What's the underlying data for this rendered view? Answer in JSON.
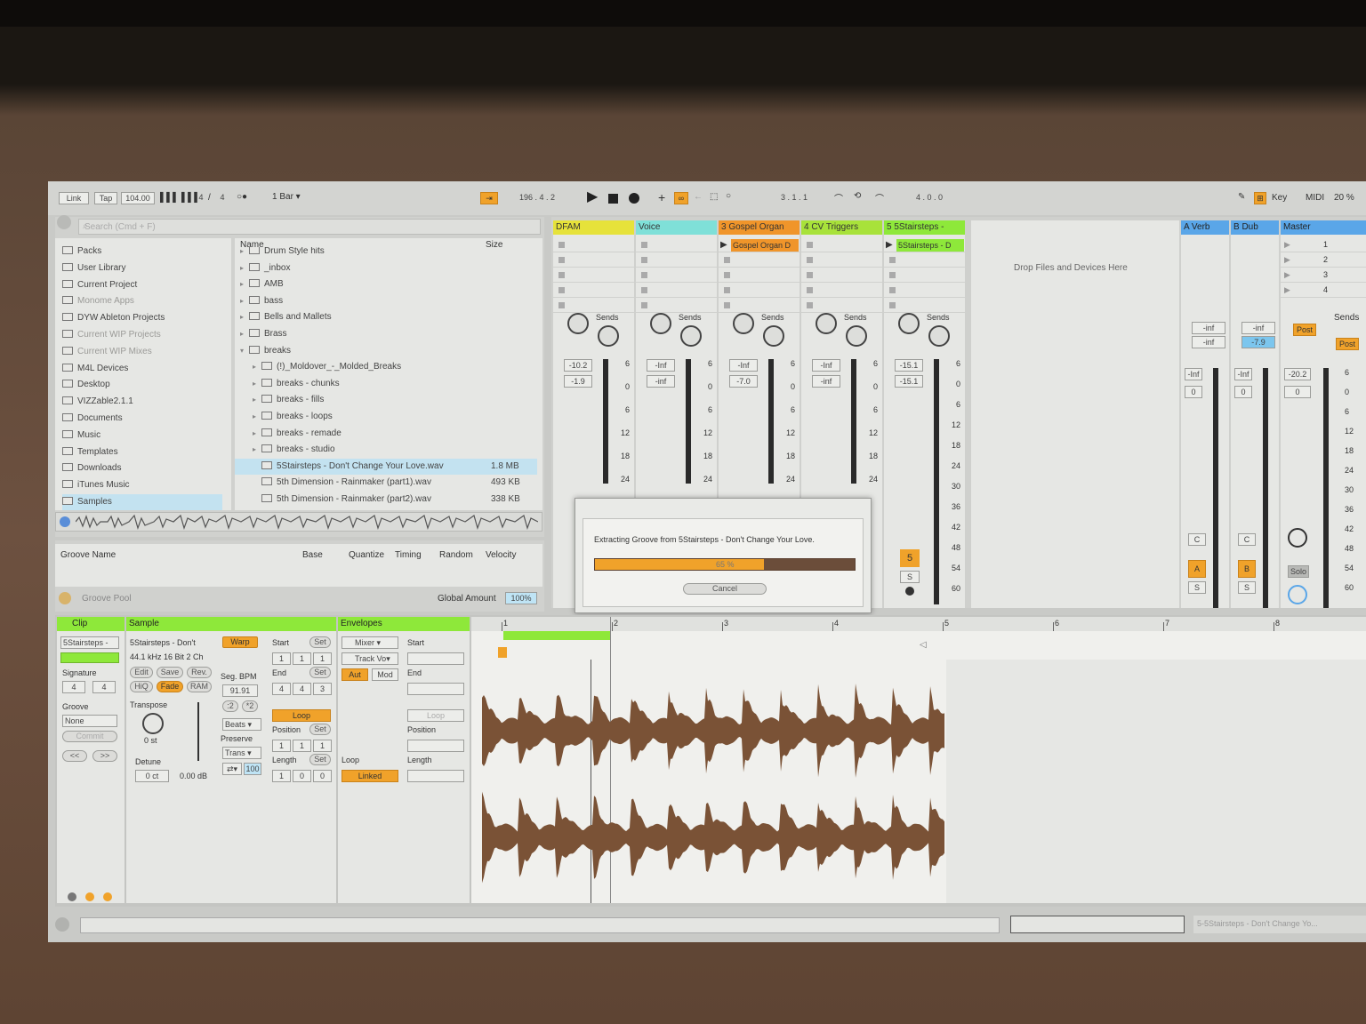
{
  "transport": {
    "link": "Link",
    "tap": "Tap",
    "tempo": "104.00",
    "signature_num": "4",
    "signature_sep": "/",
    "signature_den": "4",
    "quantize": "1 Bar",
    "position": "196 .   4 .   2",
    "loop_start": "3 .   1 .   1",
    "loop_length": "4 .   0 .   0",
    "key": "Key",
    "midi": "MIDI",
    "cpu": "20 %"
  },
  "browser": {
    "search_placeholder": "Search (Cmd + F)",
    "places": [
      {
        "label": "Packs",
        "dim": false
      },
      {
        "label": "User Library",
        "dim": false
      },
      {
        "label": "Current Project",
        "dim": false
      },
      {
        "label": "Monome Apps",
        "dim": true
      },
      {
        "label": "DYW Ableton Projects",
        "dim": false
      },
      {
        "label": "Current WIP Projects",
        "dim": true
      },
      {
        "label": "Current WIP Mixes",
        "dim": true
      },
      {
        "label": "M4L Devices",
        "dim": false
      },
      {
        "label": "Desktop",
        "dim": false
      },
      {
        "label": "VIZZable2.1.1",
        "dim": false
      },
      {
        "label": "Documents",
        "dim": false
      },
      {
        "label": "Music",
        "dim": false
      },
      {
        "label": "Templates",
        "dim": false
      },
      {
        "label": "Downloads",
        "dim": false
      },
      {
        "label": "iTunes Music",
        "dim": false
      },
      {
        "label": "Samples",
        "dim": false
      }
    ],
    "col_name": "Name",
    "col_size": "Size",
    "files": [
      {
        "name": "Drum Style hits",
        "size": "",
        "indent": 0,
        "type": "folder"
      },
      {
        "name": "_inbox",
        "size": "",
        "indent": 0,
        "type": "folder"
      },
      {
        "name": "AMB",
        "size": "",
        "indent": 0,
        "type": "folder"
      },
      {
        "name": "bass",
        "size": "",
        "indent": 0,
        "type": "folder"
      },
      {
        "name": "Bells and Mallets",
        "size": "",
        "indent": 0,
        "type": "folder"
      },
      {
        "name": "Brass",
        "size": "",
        "indent": 0,
        "type": "folder"
      },
      {
        "name": "breaks",
        "size": "",
        "indent": 0,
        "type": "folder-open"
      },
      {
        "name": "(!)_Moldover_-_Molded_Breaks",
        "size": "",
        "indent": 1,
        "type": "folder"
      },
      {
        "name": "breaks - chunks",
        "size": "",
        "indent": 1,
        "type": "folder"
      },
      {
        "name": "breaks - fills",
        "size": "",
        "indent": 1,
        "type": "folder"
      },
      {
        "name": "breaks - loops",
        "size": "",
        "indent": 1,
        "type": "folder"
      },
      {
        "name": "breaks - remade",
        "size": "",
        "indent": 1,
        "type": "folder"
      },
      {
        "name": "breaks - studio",
        "size": "",
        "indent": 1,
        "type": "folder"
      },
      {
        "name": "5Stairsteps - Don't Change Your Love.wav",
        "size": "1.8 MB",
        "indent": 1,
        "type": "file"
      },
      {
        "name": "5th Dimension - Rainmaker (part1).wav",
        "size": "493 KB",
        "indent": 1,
        "type": "file"
      },
      {
        "name": "5th Dimension - Rainmaker (part2).wav",
        "size": "338 KB",
        "indent": 1,
        "type": "file"
      }
    ]
  },
  "groove": {
    "col_name": "Groove Name",
    "col_base": "Base",
    "col_quantize": "Quantize",
    "col_timing": "Timing",
    "col_random": "Random",
    "col_velocity": "Velocity",
    "pool_label": "Groove Pool",
    "global_amount_label": "Global Amount",
    "global_amount": "100%"
  },
  "tracks": [
    {
      "name": "DFAM",
      "color": "#e6e23a",
      "clip": "",
      "vol": "-10.2",
      "pan": "-1.9"
    },
    {
      "name": "Voice",
      "color": "#7fe0d8",
      "clip": "",
      "vol": "-Inf",
      "pan": "-inf"
    },
    {
      "name": "3 Gospel Organ",
      "color": "#f0952a",
      "clip": "Gospel Organ D",
      "vol": "-Inf",
      "pan": "-7.0"
    },
    {
      "name": "4 CV Triggers",
      "color": "#a8e23a",
      "clip": "",
      "vol": "-Inf",
      "pan": "-inf"
    },
    {
      "name": "5 5Stairsteps -",
      "color": "#8ee83a",
      "clip": "5Stairsteps - D",
      "vol": "-15.1",
      "pan": "-15.1"
    }
  ],
  "returns": [
    {
      "name": "A Verb",
      "color": "#5aa6e8"
    },
    {
      "name": "B Dub",
      "color": "#5aa6e8"
    },
    {
      "name": "Master",
      "color": "#5aa6e8"
    }
  ],
  "mixer": {
    "sends": "Sends",
    "drop_hint": "Drop Files and Devices Here",
    "scale": [
      "6",
      "0",
      "6",
      "12",
      "18",
      "24"
    ],
    "scale_long": [
      "6",
      "0",
      "6",
      "12",
      "18",
      "24",
      "30",
      "36",
      "42",
      "48",
      "54",
      "60"
    ],
    "track5_number": "5",
    "solo": "S",
    "return_a": "A",
    "return_b": "B",
    "c_label": "C",
    "return_a_send_a": "-inf",
    "return_a_send_b": "-inf",
    "return_b_send_a": "-inf",
    "return_b_send_b": "-7.9",
    "return_a_vol": "-Inf",
    "return_b_vol": "-Inf",
    "master_vol": "-20.2",
    "zero": "0",
    "post": "Post",
    "solo_label": "Solo",
    "scene_numbers": [
      "1",
      "2",
      "3",
      "4"
    ]
  },
  "dialog": {
    "message": "Extracting Groove from 5Stairsteps - Don't Change Your Love.",
    "progress_label": "65 %",
    "progress": 0.65,
    "cancel": "Cancel"
  },
  "clip": {
    "title": "Clip",
    "name": "5Stairsteps -",
    "signature_label": "Signature",
    "sig_num": "4",
    "sig_den": "4",
    "groove_label": "Groove",
    "groove_value": "None",
    "commit": "Commit",
    "nav_prev": "<<",
    "nav_next": ">>"
  },
  "sample": {
    "title": "Sample",
    "name": "5Stairsteps - Don't",
    "format": "44.1 kHz 16 Bit 2 Ch",
    "edit": "Edit",
    "save": "Save",
    "rev": "Rev.",
    "hiq": "HiQ",
    "fade": "Fade",
    "ram": "RAM",
    "transpose_label": "Transpose",
    "transpose": "0 st",
    "detune_label": "Detune",
    "detune": "0 ct",
    "gain": "0.00 dB",
    "warp": "Warp",
    "seg_bpm_label": "Seg. BPM",
    "seg_bpm": "91.91",
    "half": ":2",
    "double": "*2",
    "mode": "Beats",
    "preserve_label": "Preserve",
    "preserve": "Trans",
    "grain": "100",
    "start_label": "Start",
    "end_label": "End",
    "set": "Set",
    "loop": "Loop",
    "position_label": "Position",
    "length_label": "Length",
    "start": [
      "1",
      "1",
      "1"
    ],
    "end": [
      "4",
      "4",
      "3"
    ],
    "position": [
      "1",
      "1",
      "1"
    ],
    "length": [
      "1",
      "0",
      "0"
    ]
  },
  "envelopes": {
    "title": "Envelopes",
    "device": "Mixer",
    "control": "Track Vo",
    "aut": "Aut",
    "mod": "Mod",
    "start_label": "Start",
    "end_label": "End",
    "loop": "Loop",
    "position_label": "Position",
    "length_label": "Length",
    "loop_label": "Loop",
    "linked": "Linked"
  },
  "timeline": {
    "markers": [
      "1",
      "2",
      "3",
      "4",
      "5",
      "6",
      "7",
      "8"
    ]
  },
  "status": {
    "clip_name": "5-5Stairsteps - Don't Change Yo..."
  }
}
